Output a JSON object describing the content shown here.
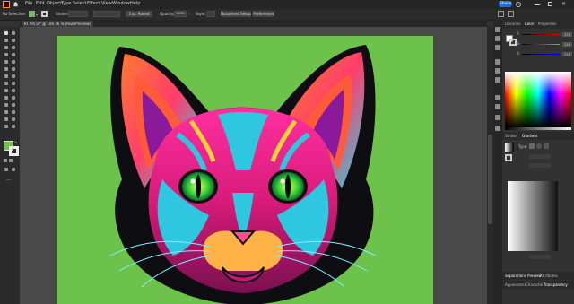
{
  "menu": [
    "File",
    "Edit",
    "Object",
    "Type",
    "Select",
    "Effect",
    "View",
    "Window",
    "Help"
  ],
  "share_label": "Share",
  "control": {
    "selection": "No Selection",
    "stroke_label": "Stroke:",
    "brush": "5 pt. Round",
    "opacity_label": "Opacity:",
    "opacity_value": "100%",
    "style_label": "Style:",
    "document_setup": "Document Setup",
    "preferences": "Preferences"
  },
  "document_tab": "KT Art.ai* @ 106.76 % (RGB/Preview)",
  "panels": {
    "top_tabs": [
      "Libraries",
      "Color",
      "Properties"
    ],
    "channels": [
      {
        "name": "R",
        "value": "255"
      },
      {
        "name": "G",
        "value": "255"
      },
      {
        "name": "B",
        "value": "255"
      }
    ],
    "middle_tabs": [
      "Stroke",
      "Gradient"
    ],
    "gradient_type_label": "Type:",
    "bottom_tabs_1": [
      "Separations Preview",
      "Attributes"
    ],
    "bottom_tabs_2": [
      "Appearance",
      "Character",
      "Transparency"
    ]
  },
  "colors": {
    "artboard": "#6cc24a",
    "accent": "#1473e6"
  }
}
